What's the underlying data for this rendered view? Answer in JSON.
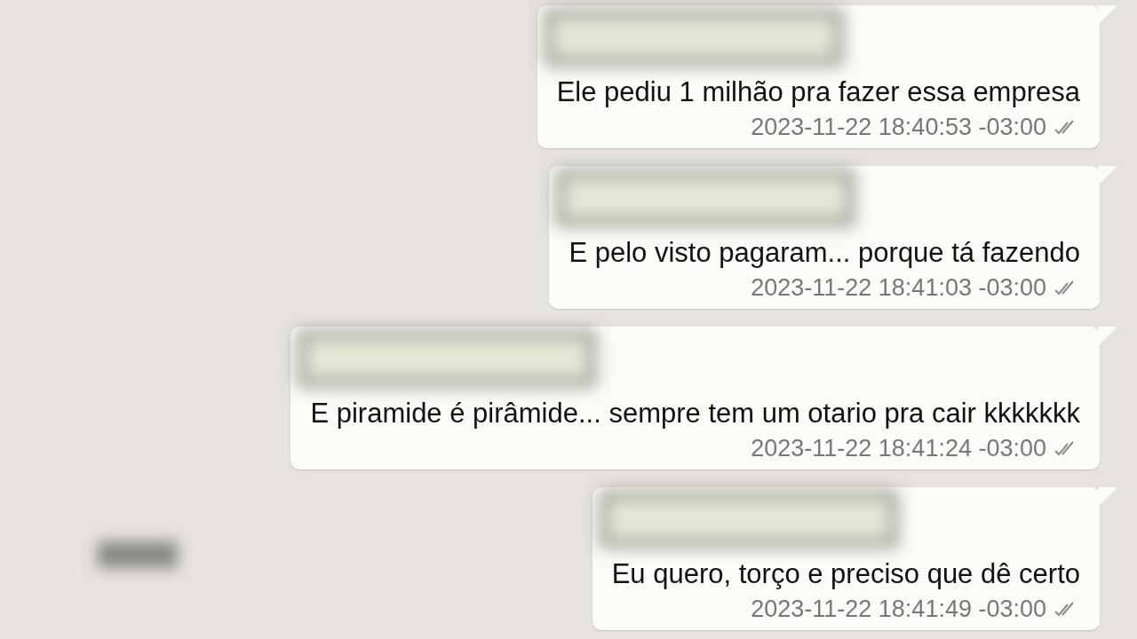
{
  "messages": [
    {
      "text": "Ele pediu 1 milhão pra fazer essa empresa",
      "timestamp": "2023-11-22 18:40:53 -03:00"
    },
    {
      "text": "E pelo visto pagaram... porque tá fazendo",
      "timestamp": "2023-11-22 18:41:03 -03:00"
    },
    {
      "text": "E piramide é pirâmide... sempre tem um otario pra cair kkkkkkk",
      "timestamp": "2023-11-22 18:41:24 -03:00"
    },
    {
      "text": "Eu quero, torço e preciso que dê certo",
      "timestamp": "2023-11-22 18:41:49 -03:00"
    }
  ]
}
